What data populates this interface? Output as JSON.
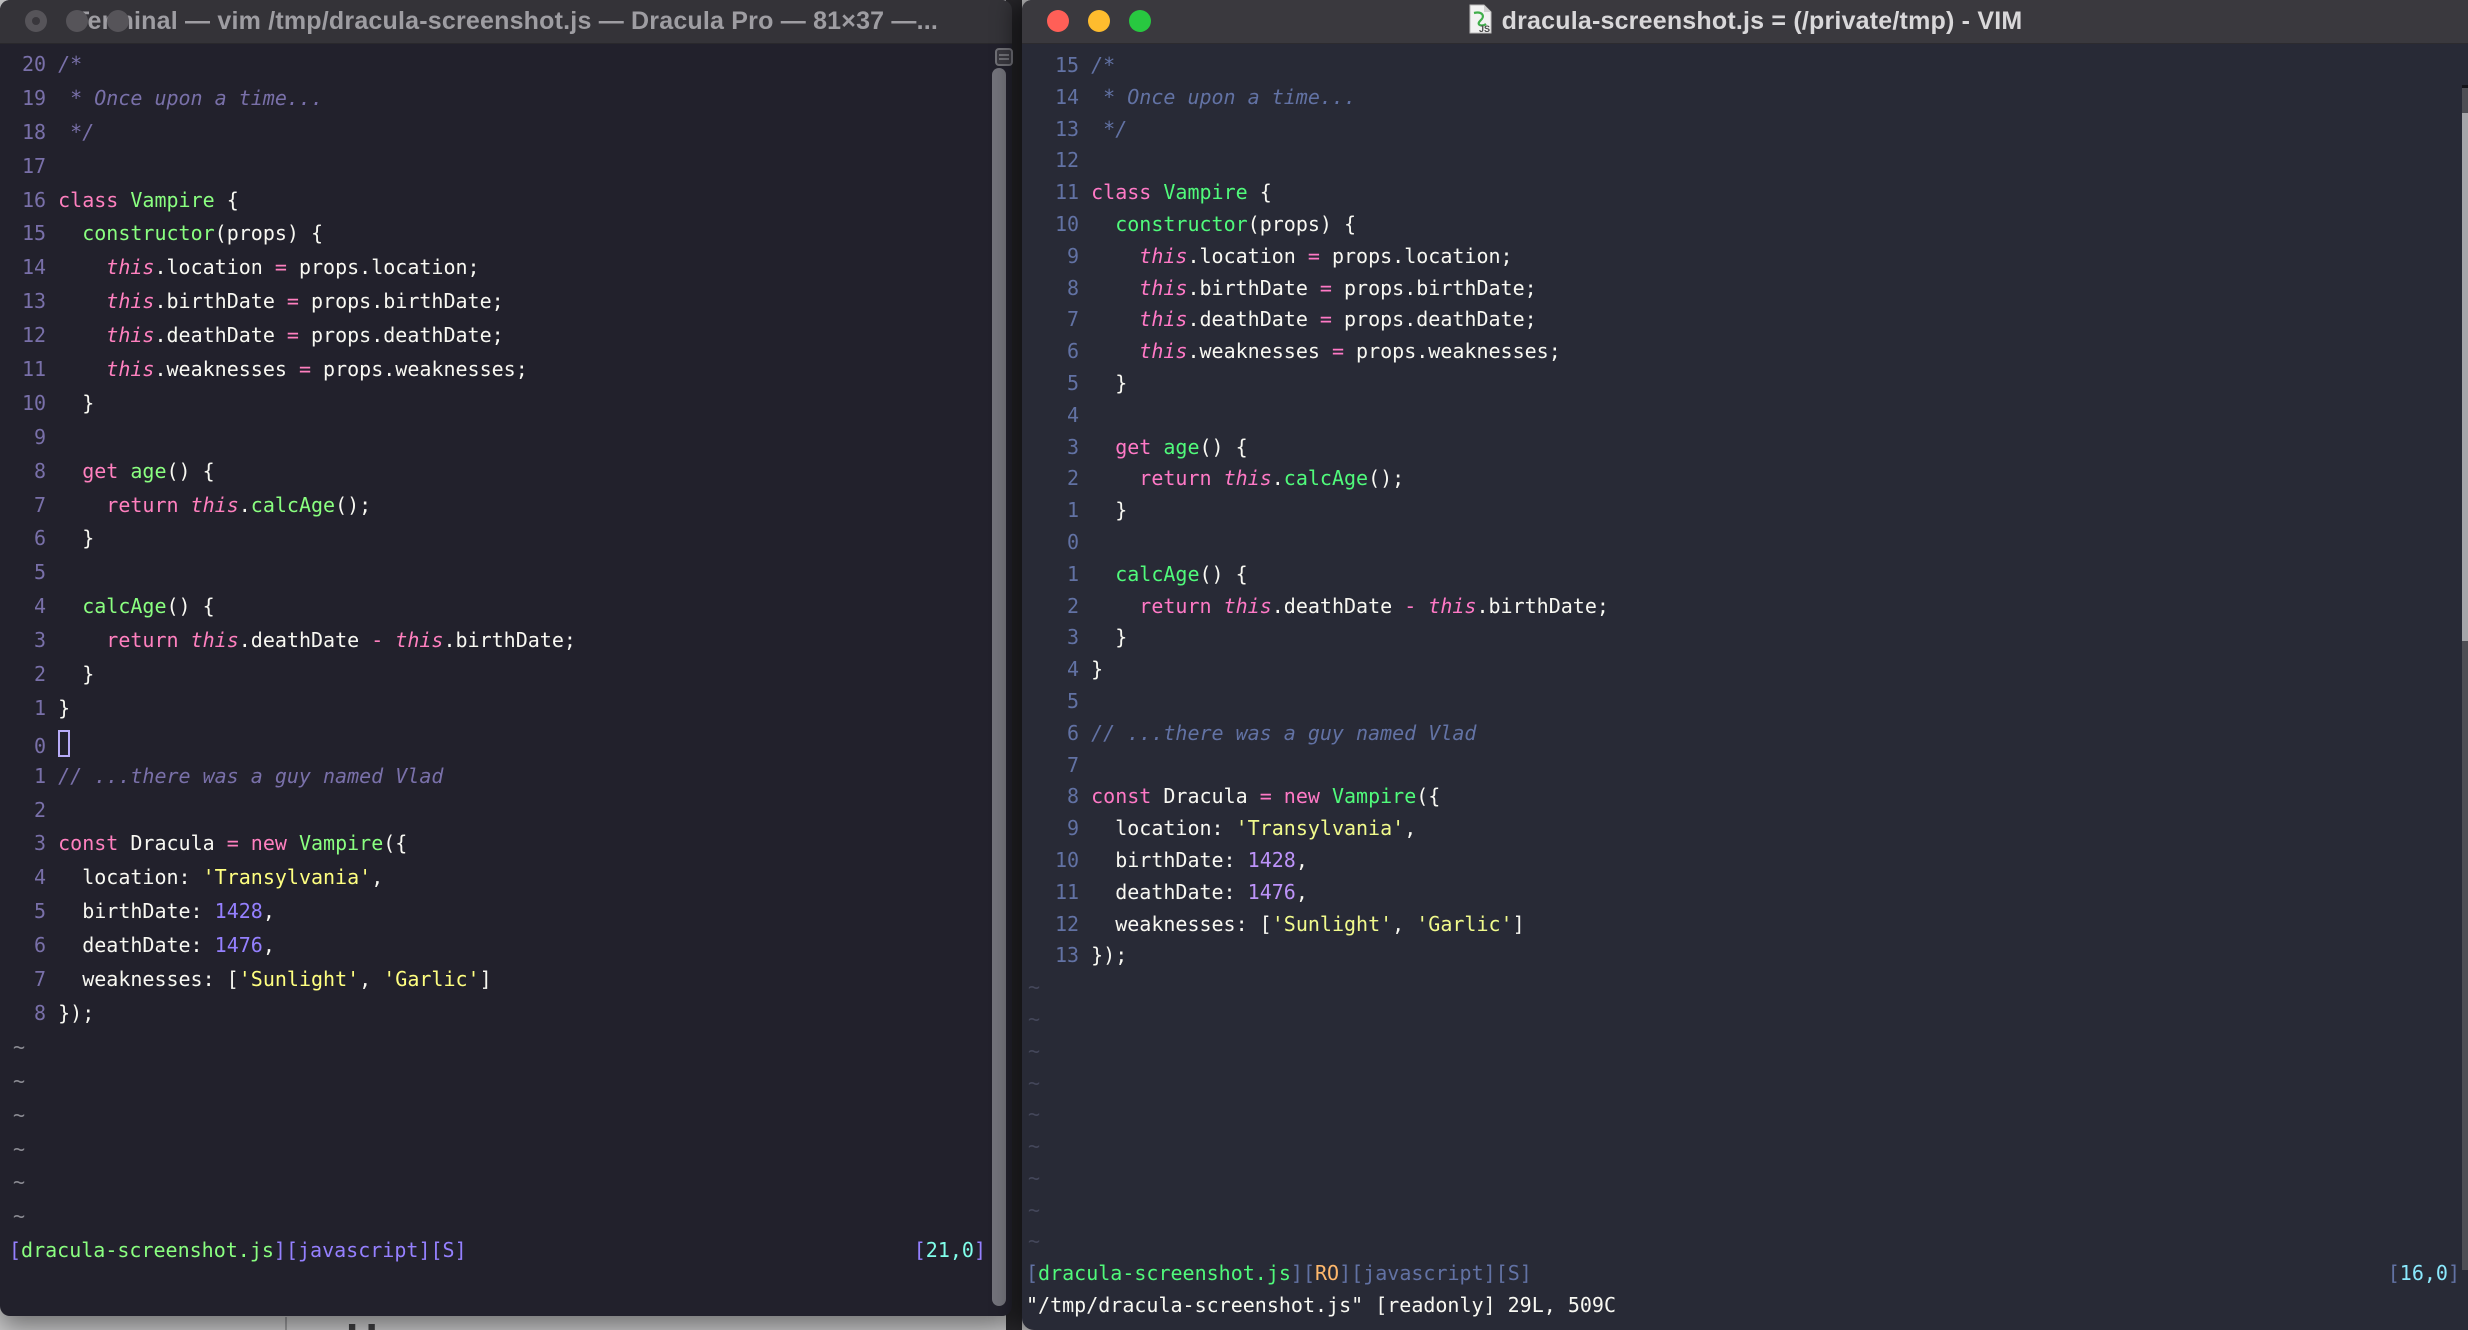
{
  "colors": {
    "desktop": "#c9c9ca",
    "left_bg": "#22212c",
    "left_titlebar": "#343338",
    "left_title_text": "#9e9da2",
    "left_linenr": "#7970a9",
    "left_comment": "#7970a9",
    "left_pink": "#ff80bf",
    "left_green": "#8aff80",
    "left_yellow": "#ffff80",
    "left_purple": "#9580ff",
    "left_cyan": "#80ffea",
    "left_fg": "#f8f8f2",
    "left_tilde": "#8a8a92",
    "right_bg": "#282a36",
    "right_titlebar": "#3a393e",
    "right_title_text": "#d9d8da",
    "right_linenr": "#6272a4",
    "right_comment": "#6272a4",
    "right_pink": "#ff79c6",
    "right_green": "#50fa7b",
    "right_yellow": "#f1fa8c",
    "right_purple": "#bd93f9",
    "right_cyan": "#8be9fd",
    "right_orange": "#ffb86c",
    "right_fg": "#f8f8f2",
    "right_tilde": "#44475a",
    "traffic_red": "#ff5f57",
    "traffic_yellow": "#febc2e",
    "traffic_green": "#28c840",
    "inactive_light": "#565459"
  },
  "code_lines": [
    [
      [
        "c",
        "/*"
      ]
    ],
    [
      [
        "c",
        " * Once upon a time..."
      ]
    ],
    [
      [
        "c",
        " */"
      ]
    ],
    [],
    [
      [
        "k",
        "class"
      ],
      [
        "d",
        " "
      ],
      [
        "f",
        "Vampire"
      ],
      [
        "d",
        " {"
      ]
    ],
    [
      [
        "d",
        "  "
      ],
      [
        "f",
        "constructor"
      ],
      [
        "d",
        "(props) {"
      ]
    ],
    [
      [
        "d",
        "    "
      ],
      [
        "t",
        "this"
      ],
      [
        "d",
        ".location "
      ],
      [
        "k",
        "="
      ],
      [
        "d",
        " props.location;"
      ]
    ],
    [
      [
        "d",
        "    "
      ],
      [
        "t",
        "this"
      ],
      [
        "d",
        ".birthDate "
      ],
      [
        "k",
        "="
      ],
      [
        "d",
        " props.birthDate;"
      ]
    ],
    [
      [
        "d",
        "    "
      ],
      [
        "t",
        "this"
      ],
      [
        "d",
        ".deathDate "
      ],
      [
        "k",
        "="
      ],
      [
        "d",
        " props.deathDate;"
      ]
    ],
    [
      [
        "d",
        "    "
      ],
      [
        "t",
        "this"
      ],
      [
        "d",
        ".weaknesses "
      ],
      [
        "k",
        "="
      ],
      [
        "d",
        " props.weaknesses;"
      ]
    ],
    [
      [
        "d",
        "  }"
      ]
    ],
    [],
    [
      [
        "d",
        "  "
      ],
      [
        "k",
        "get"
      ],
      [
        "d",
        " "
      ],
      [
        "f",
        "age"
      ],
      [
        "d",
        "() {"
      ]
    ],
    [
      [
        "d",
        "    "
      ],
      [
        "k",
        "return"
      ],
      [
        "d",
        " "
      ],
      [
        "t",
        "this"
      ],
      [
        "d",
        "."
      ],
      [
        "f",
        "calcAge"
      ],
      [
        "d",
        "();"
      ]
    ],
    [
      [
        "d",
        "  }"
      ]
    ],
    [],
    [
      [
        "d",
        "  "
      ],
      [
        "f",
        "calcAge"
      ],
      [
        "d",
        "() {"
      ]
    ],
    [
      [
        "d",
        "    "
      ],
      [
        "k",
        "return"
      ],
      [
        "d",
        " "
      ],
      [
        "t",
        "this"
      ],
      [
        "d",
        ".deathDate "
      ],
      [
        "k",
        "-"
      ],
      [
        "d",
        " "
      ],
      [
        "t",
        "this"
      ],
      [
        "d",
        ".birthDate;"
      ]
    ],
    [
      [
        "d",
        "  }"
      ]
    ],
    [
      [
        "d",
        "}"
      ]
    ],
    [],
    [
      [
        "c",
        "// ...there was a guy named Vlad"
      ]
    ],
    [],
    [
      [
        "k",
        "const"
      ],
      [
        "d",
        " Dracula "
      ],
      [
        "k",
        "="
      ],
      [
        "d",
        " "
      ],
      [
        "k",
        "new"
      ],
      [
        "d",
        " "
      ],
      [
        "f",
        "Vampire"
      ],
      [
        "d",
        "({"
      ]
    ],
    [
      [
        "d",
        "  location: "
      ],
      [
        "s",
        "'Transylvania'"
      ],
      [
        "d",
        ","
      ]
    ],
    [
      [
        "d",
        "  birthDate: "
      ],
      [
        "n",
        "1428"
      ],
      [
        "d",
        ","
      ]
    ],
    [
      [
        "d",
        "  deathDate: "
      ],
      [
        "n",
        "1476"
      ],
      [
        "d",
        ","
      ]
    ],
    [
      [
        "d",
        "  weaknesses: ["
      ],
      [
        "s",
        "'Sunlight'"
      ],
      [
        "d",
        ", "
      ],
      [
        "s",
        "'Garlic'"
      ],
      [
        "d",
        "]"
      ]
    ],
    [
      [
        "d",
        "});"
      ]
    ]
  ],
  "left_window": {
    "title": "Terminal — vim /tmp/dracula-screenshot.js — Dracula Pro — 81×37 —...",
    "rel_numbers": [
      "20",
      "19",
      "18",
      "17",
      "16",
      "15",
      "14",
      "13",
      "12",
      "11",
      "10",
      "9",
      "8",
      "7",
      "6",
      "5",
      "4",
      "3",
      "2",
      "1",
      "0",
      "1",
      "2",
      "3",
      "4",
      "5",
      "6",
      "7",
      "8"
    ],
    "cursor_index": 20,
    "tilde_count": 6,
    "status_tokens": [
      [
        "br",
        "["
      ],
      [
        "fn",
        "dracula-screenshot.js"
      ],
      [
        "br",
        "]["
      ],
      [
        "ft",
        "javascript"
      ],
      [
        "br",
        "]["
      ],
      [
        "ft",
        "S"
      ],
      [
        "br",
        "]"
      ]
    ],
    "ruler_tokens": [
      [
        "br",
        "["
      ],
      [
        "pos",
        "21,0"
      ],
      [
        "br",
        "]"
      ]
    ]
  },
  "right_window": {
    "title": "dracula-screenshot.js = (/private/tmp) - VIM",
    "rel_numbers": [
      "15",
      "14",
      "13",
      "12",
      "11",
      "10",
      "9",
      "8",
      "7",
      "6",
      "5",
      "4",
      "3",
      "2",
      "1",
      "0",
      "1",
      "2",
      "3",
      "4",
      "5",
      "6",
      "7",
      "8",
      "9",
      "10",
      "11",
      "12",
      "13"
    ],
    "cursor_index": -1,
    "tilde_count": 9,
    "status_tokens": [
      [
        "br",
        "["
      ],
      [
        "fn",
        "dracula-screenshot.js"
      ],
      [
        "br",
        "]["
      ],
      [
        "ro",
        "RO"
      ],
      [
        "br",
        "]["
      ],
      [
        "ft",
        "javascript"
      ],
      [
        "br",
        "]["
      ],
      [
        "ft",
        "S"
      ],
      [
        "br",
        "]"
      ]
    ],
    "ruler_tokens": [
      [
        "br",
        "["
      ],
      [
        "pos",
        "16,0"
      ],
      [
        "br",
        "]"
      ]
    ],
    "message": "\"/tmp/dracula-screenshot.js\" [readonly] 29L, 509C"
  },
  "desktop_artifacts": {
    "background_letter": "H"
  }
}
